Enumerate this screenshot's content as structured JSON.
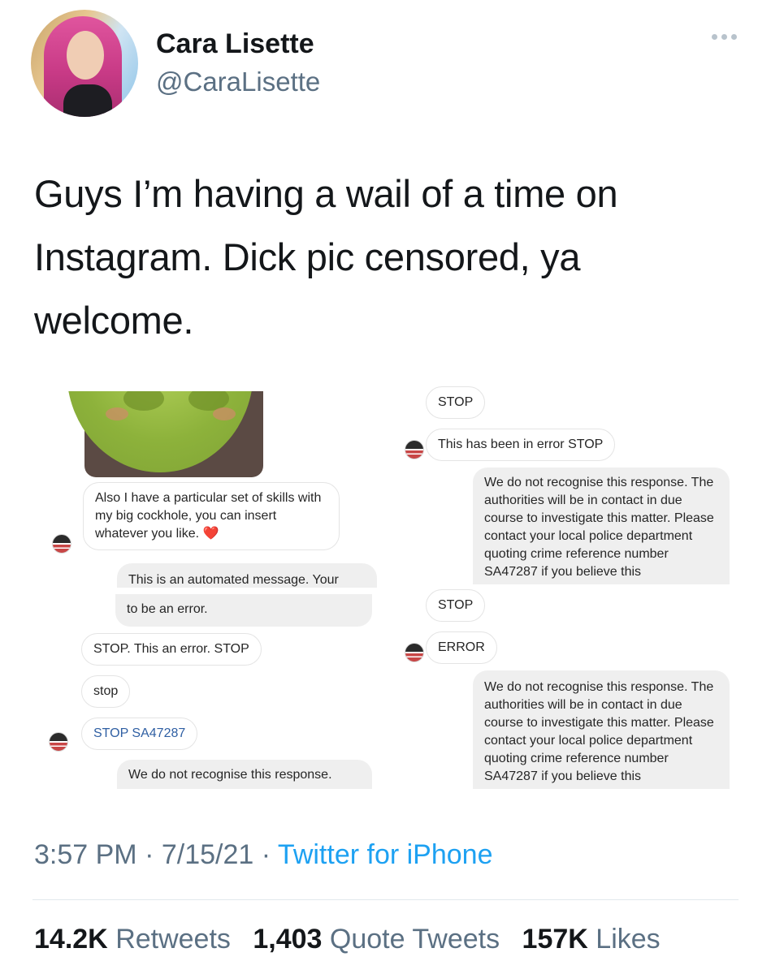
{
  "user": {
    "display_name": "Cara Lisette",
    "handle": "@CaraLisette"
  },
  "tweet": {
    "text": "Guys I’m having a wail of a time on Instagram. Dick pic censored, ya welcome."
  },
  "left_screenshot": {
    "messages": [
      "Also I have a particular set of skills with my big cockhole, you can insert whatever you like. ❤️",
      "This is an automated message. Your",
      "to be an error.",
      "STOP. This an error. STOP",
      "stop",
      "STOP SA47287",
      "We do not recognise this response."
    ]
  },
  "right_screenshot": {
    "messages": [
      "STOP",
      "This has been in error STOP",
      "We do not recognise this response. The authorities will be in contact in due course to investigate this matter. Please contact your local police department quoting crime reference number SA47287 if you believe this",
      "STOP",
      "ERROR",
      "We do not recognise this response. The authorities will be in contact in due course to investigate this matter. Please contact your local police department quoting crime reference number SA47287 if you believe this"
    ]
  },
  "meta": {
    "time": "3:57 PM",
    "date": "7/15/21",
    "source": "Twitter for iPhone"
  },
  "stats": {
    "retweets_count": "14.2K",
    "retweets_label": "Retweets",
    "quotes_count": "1,403",
    "quotes_label": "Quote Tweets",
    "likes_count": "157K",
    "likes_label": "Likes"
  },
  "icons": {
    "more": "more-horizontal-icon"
  }
}
